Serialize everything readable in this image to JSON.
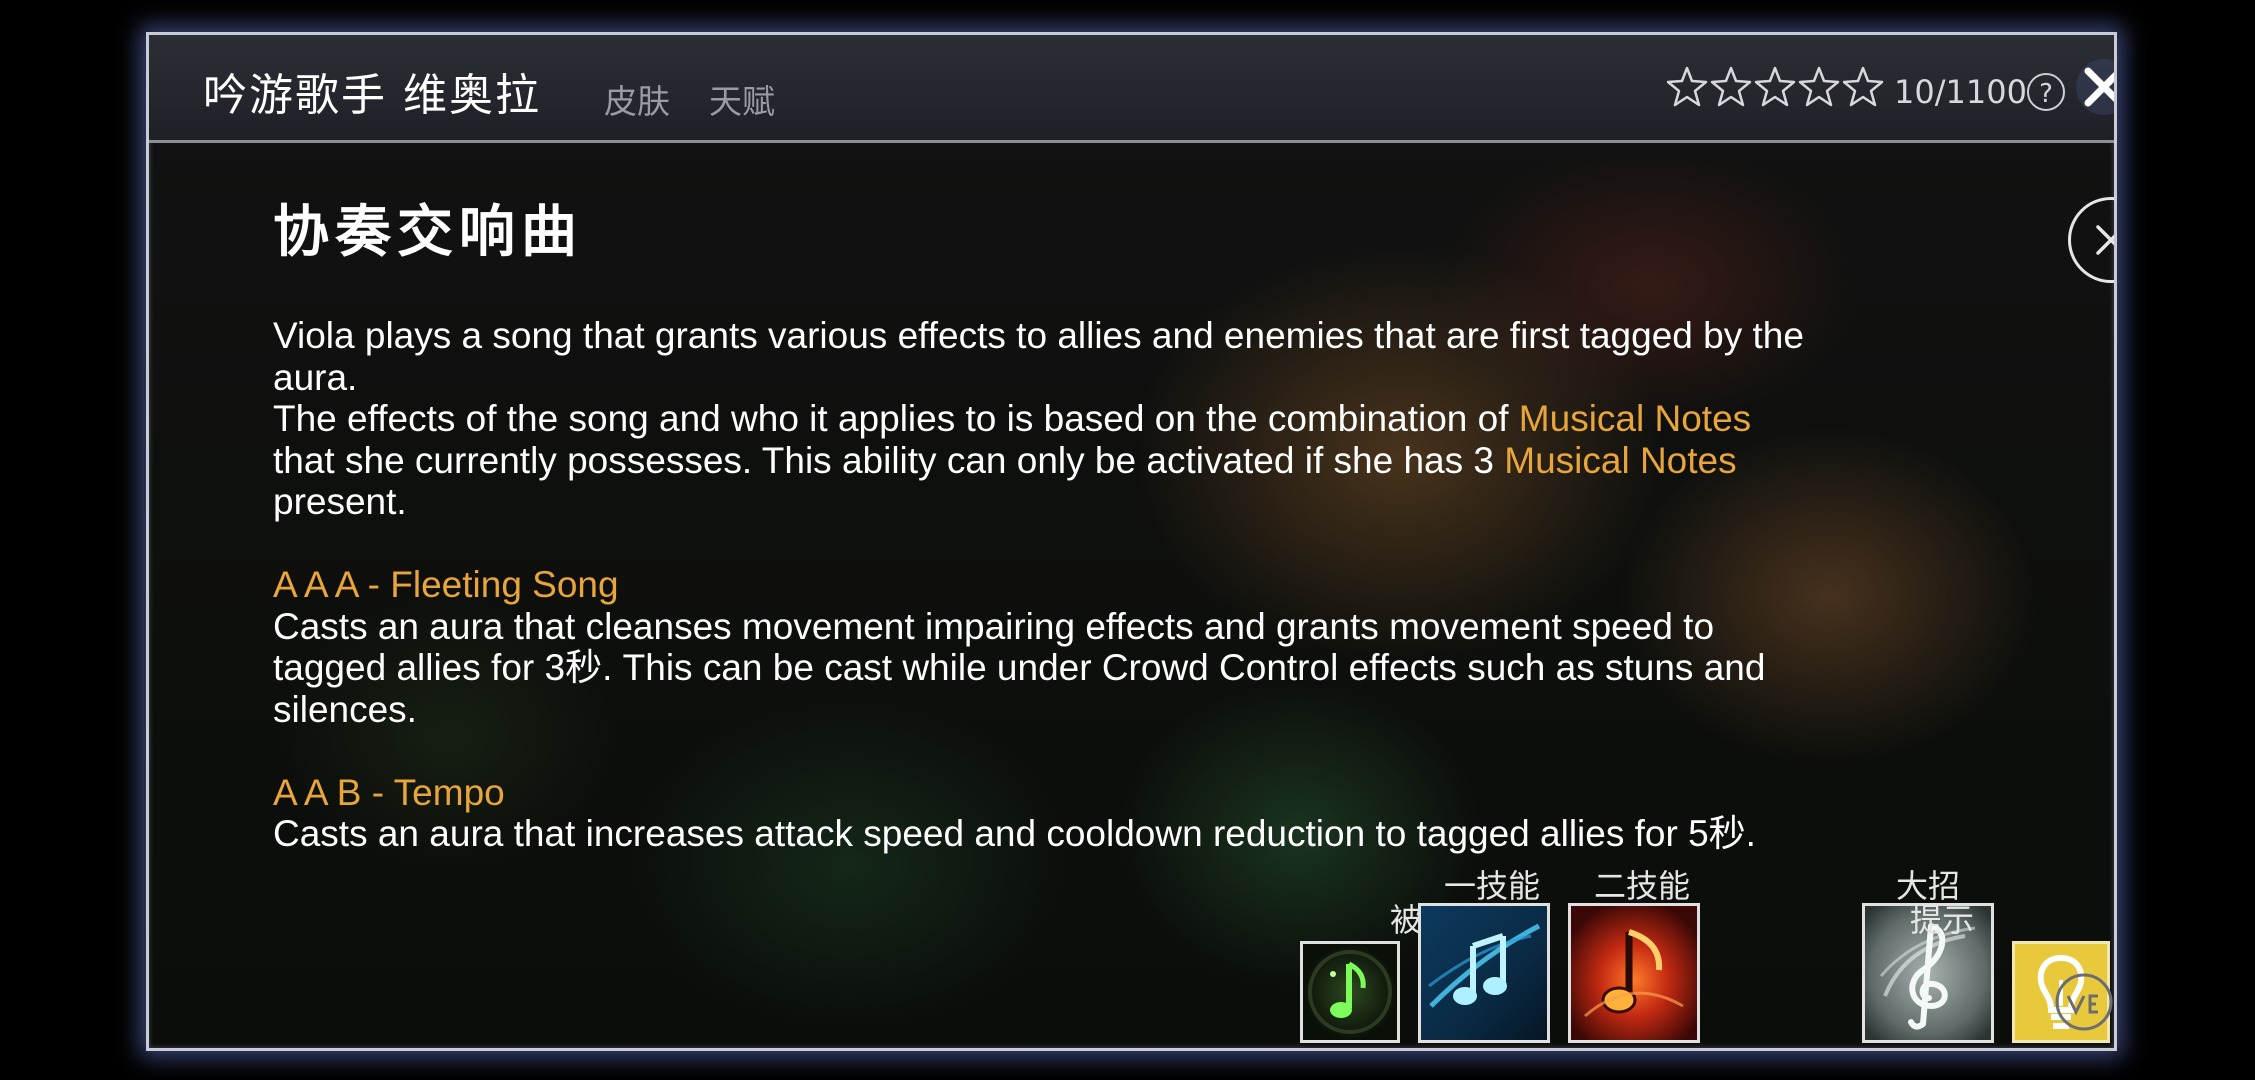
{
  "header": {
    "hero_name": "吟游歌手 维奥拉",
    "tabs": [
      "皮肤",
      "天赋"
    ],
    "star_count": 5,
    "stars_filled": 0,
    "rating": "10/1100",
    "help_icon_glyph": "?",
    "close_icon": "close-x-icon"
  },
  "skill": {
    "title": "协奏交响曲",
    "intro_line1": "Viola plays a song that grants various effects to allies and enemies that are first tagged by the",
    "intro_line2": "aura.",
    "intro_line3_a": "The effects of the song and who it applies to is based on the combination of ",
    "intro_line3_b": "Musical Notes",
    "intro_line4_a": "that she currently possesses. This ability can only be activated if she has 3 ",
    "intro_line4_b": "Musical Notes",
    "intro_line5": "present.",
    "combos": [
      {
        "name": "A A A - Fleeting Song",
        "lines": [
          "Casts an aura that cleanses movement impairing effects and grants movement speed to",
          "tagged allies for 3秒. This can be cast while under Crowd Control effects such as stuns and",
          "silences."
        ]
      },
      {
        "name": "A A B - Tempo",
        "lines": [
          "Casts an aura that increases attack speed and cooldown reduction to tagged allies for 5秒."
        ]
      }
    ]
  },
  "skill_bar": {
    "passive": "被动",
    "skill1": "一技能",
    "skill2": "二技能",
    "ultimate": "大招",
    "tips": "提示"
  },
  "colors": {
    "highlight": "#e7a53b",
    "panel_glow": "#6e82dc",
    "tips_bg": "#e8c93c"
  }
}
